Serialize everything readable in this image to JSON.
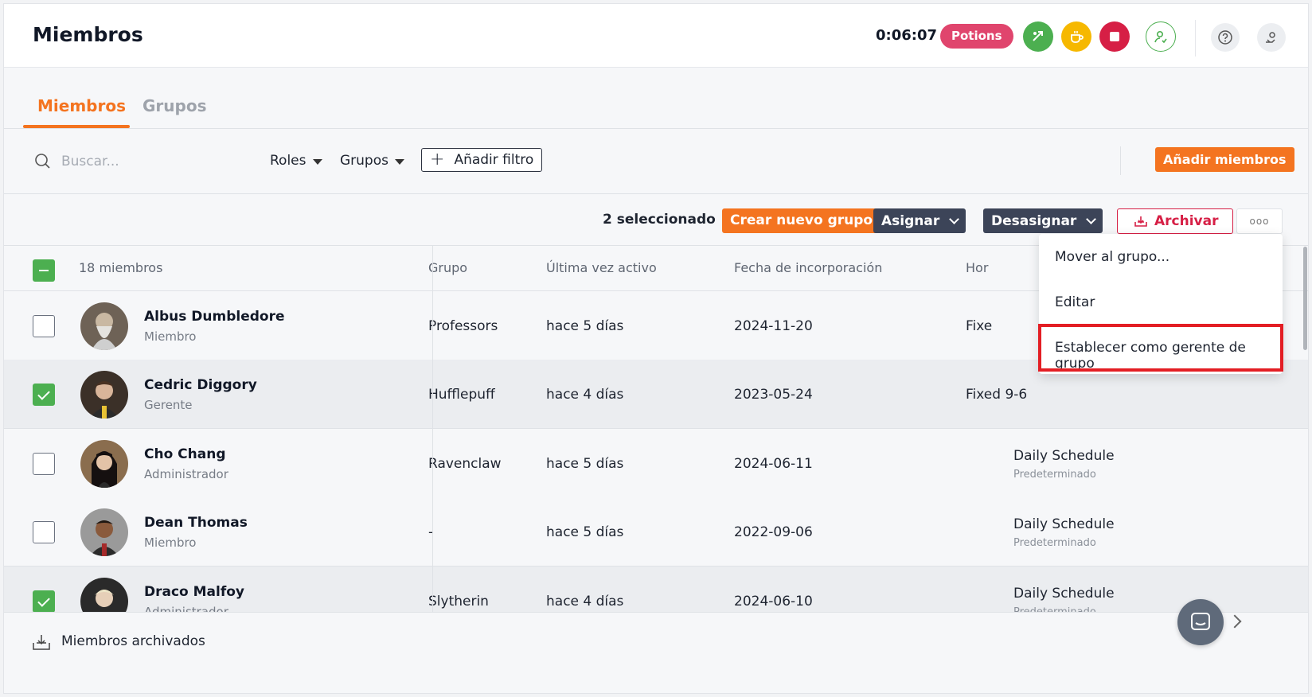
{
  "header": {
    "title": "Miembros",
    "timer": "0:06:07",
    "project": "Potions",
    "colors": {
      "accent": "#f47420",
      "green": "#4caf50",
      "yellow": "#f6b800",
      "red": "#d61f45",
      "pill": "#e0456d"
    },
    "icons": [
      "switch-activity-icon",
      "break-cup-icon",
      "stop-icon",
      "user-status-icon",
      "help-icon",
      "settings-icon"
    ]
  },
  "tabs": [
    {
      "label": "Miembros",
      "active": true
    },
    {
      "label": "Grupos",
      "active": false
    }
  ],
  "filters": {
    "search_placeholder": "Buscar...",
    "roles": "Roles",
    "groups": "Grupos",
    "add_filter": "Añadir filtro",
    "add_members": "Añadir miembros"
  },
  "actions": {
    "selected": "2 seleccionado",
    "create_group": "Crear nuevo grupo",
    "assign": "Asignar",
    "unassign": "Desasignar",
    "archive": "Archivar",
    "more": "ooo"
  },
  "table": {
    "headers": {
      "members": "18 miembros",
      "group": "Grupo",
      "last_active": "Última vez activo",
      "joined": "Fecha de incorporación",
      "schedule": "Hor"
    },
    "rows": [
      {
        "name": "Albus Dumbledore",
        "role": "Miembro",
        "group": "Professors",
        "last": "hace 5 días",
        "date": "2024-11-20",
        "schedule": "Fixe",
        "schedule_sub": "",
        "selected": false
      },
      {
        "name": "Cedric Diggory",
        "role": "Gerente",
        "group": "Hufflepuff",
        "last": "hace 4 días",
        "date": "2023-05-24",
        "schedule": "Fixed 9-6",
        "schedule_sub": "",
        "selected": true
      },
      {
        "name": "Cho Chang",
        "role": "Administrador",
        "group": "Ravenclaw",
        "last": "hace 5 días",
        "date": "2024-06-11",
        "schedule": "Daily Schedule",
        "schedule_sub": "Predeterminado",
        "selected": false
      },
      {
        "name": "Dean Thomas",
        "role": "Miembro",
        "group": "-",
        "last": "hace 5 días",
        "date": "2022-09-06",
        "schedule": "Daily Schedule",
        "schedule_sub": "Predeterminado",
        "selected": false
      },
      {
        "name": "Draco Malfoy",
        "role": "Administrador",
        "group": "Slytherin",
        "last": "hace 4 días",
        "date": "2024-06-10",
        "schedule": "Daily Schedule",
        "schedule_sub": "Predeterminado",
        "selected": true
      }
    ]
  },
  "menu": {
    "items": [
      "Mover al grupo...",
      "Editar",
      "Establecer como gerente de grupo"
    ]
  },
  "footer": {
    "archived": "Miembros archivados"
  }
}
